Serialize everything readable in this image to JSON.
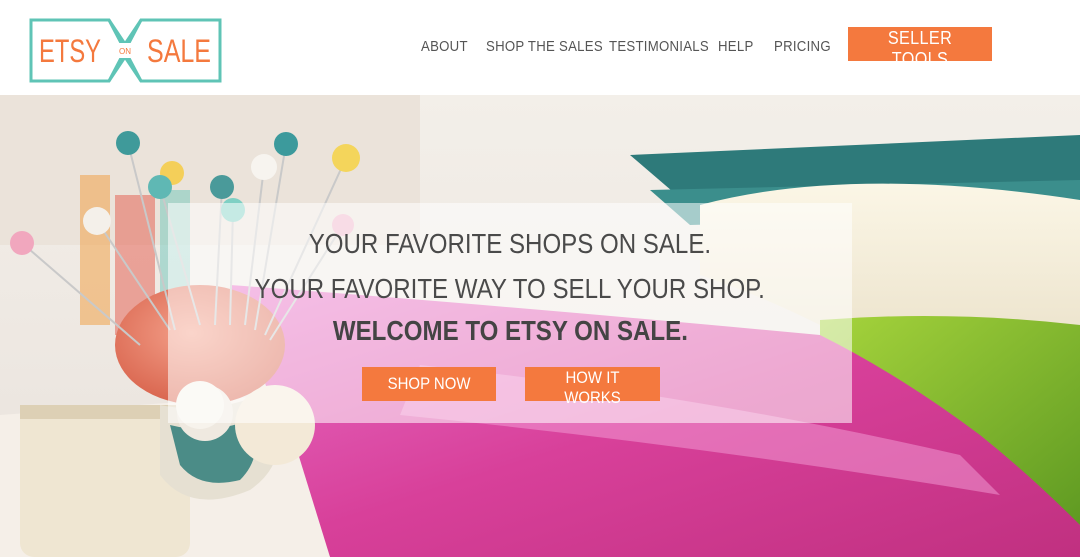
{
  "brand": {
    "logo_word_left": "ETSY",
    "logo_word_mid": "ON",
    "logo_word_right": "SALE",
    "logo_color": "#5fc4b6",
    "text_color": "#f4793e"
  },
  "nav": {
    "items": [
      {
        "label": "ABOUT"
      },
      {
        "label": "SHOP THE SALES"
      },
      {
        "label": "TESTIMONIALS"
      },
      {
        "label": "HELP"
      },
      {
        "label": "PRICING"
      }
    ],
    "seller_tools_label": "SELLER TOOLS"
  },
  "hero": {
    "line1": "YOUR FAVORITE SHOPS ON SALE.",
    "line2": "YOUR FAVORITE WAY TO SELL YOUR SHOP.",
    "line3": "WELCOME TO ETSY ON SALE.",
    "shop_now_label": "SHOP NOW",
    "how_it_works_label": "HOW IT WORKS"
  },
  "colors": {
    "accent": "#f4793e",
    "teal": "#5fc4b6",
    "text": "#4a4a4a"
  }
}
